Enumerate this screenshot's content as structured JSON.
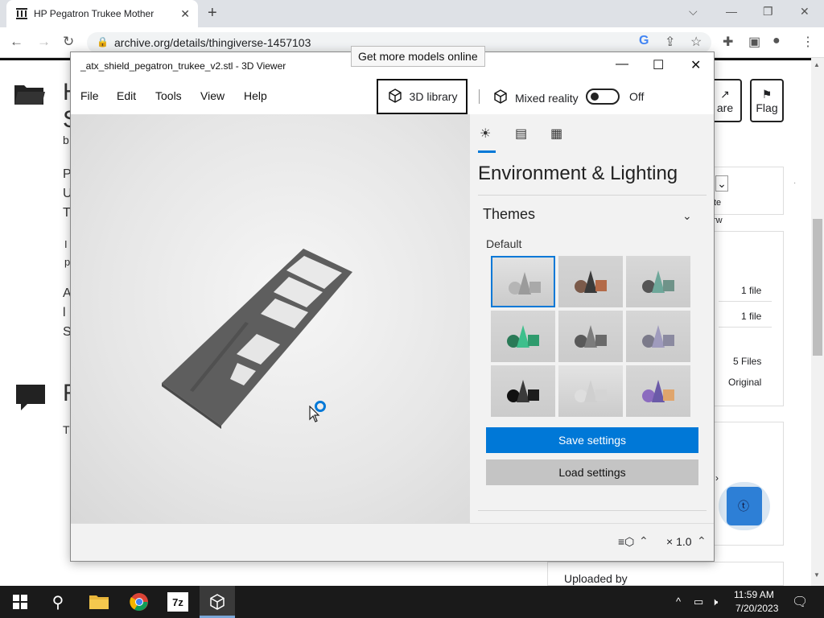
{
  "browser": {
    "tab_title": "HP Pegatron Trukee Motherboar",
    "url": "archive.org/details/thingiverse-1457103",
    "new_tab": "+",
    "tab_close": "✕"
  },
  "page": {
    "heading_fragment_1": "H",
    "heading_fragment_2": "S",
    "sub_fragment": "b",
    "para_letters": [
      "P",
      "U",
      "T"
    ],
    "para2_letters": [
      "I",
      "p"
    ],
    "para3_letters": [
      "A",
      "l",
      "S"
    ],
    "reviews_letter": "R",
    "t_letter": "T",
    "share_label": "are",
    "flag_label": "Flag",
    "panel_texts": {
      "f1": "1 file",
      "f2": "1 file",
      "files": "5 Files",
      "original": "Original",
      "ate": "te",
      "rw": "rw"
    },
    "uploaded_by": "Uploaded by"
  },
  "viewer": {
    "title": "_atx_shield_pegatron_trukee_v2.stl - 3D Viewer",
    "menus": [
      "File",
      "Edit",
      "Tools",
      "View",
      "Help"
    ],
    "library_label": "3D library",
    "mixed_reality": "Mixed reality",
    "toggle_state": "Off",
    "tooltip": "Get more models online",
    "panel_title": "Environment & Lighting",
    "themes_label": "Themes",
    "default_label": "Default",
    "save_label": "Save settings",
    "load_label": "Load settings",
    "zoom": "× 1.0"
  },
  "themes": [
    {
      "name": "default",
      "bg": "#e2e2e2",
      "cube": "#a9a9a9",
      "cone": "#9b9b9b",
      "sphere": "#b5b5b5"
    },
    {
      "name": "warm",
      "bg": "#d3d3d3",
      "cube": "#b36a48",
      "cone": "#3a3a3a",
      "sphere": "#7b5a4a"
    },
    {
      "name": "teal",
      "bg": "#d8d8d8",
      "cube": "#6f9389",
      "cone": "#6ea79a",
      "sphere": "#555"
    },
    {
      "name": "green",
      "bg": "#d6d6d6",
      "cube": "#2f9b6d",
      "cone": "#3ebf8c",
      "sphere": "#2a7a57"
    },
    {
      "name": "gray",
      "bg": "#d6d6d6",
      "cube": "#6a6a6a",
      "cone": "#7c7c7c",
      "sphere": "#595959"
    },
    {
      "name": "lavender",
      "bg": "#d6d6d6",
      "cube": "#8b8aa0",
      "cone": "#9f9bbd",
      "sphere": "#7b7a8a"
    },
    {
      "name": "dark",
      "bg": "#d6d6d6",
      "cube": "#1c1c1c",
      "cone": "#3a3a3a",
      "sphere": "#111"
    },
    {
      "name": "pale",
      "bg": "#e3e3e3",
      "cube": "#d4d4d4",
      "cone": "#cfcfcf",
      "sphere": "#dedede"
    },
    {
      "name": "sunset",
      "bg": "#d6d6d6",
      "cube": "#e0a56c",
      "cone": "#6b5aa8",
      "sphere": "#8b6bbf"
    }
  ],
  "taskbar": {
    "time": "11:59 AM",
    "date": "7/20/2023"
  },
  "colors": {
    "accent": "#0078d7"
  }
}
